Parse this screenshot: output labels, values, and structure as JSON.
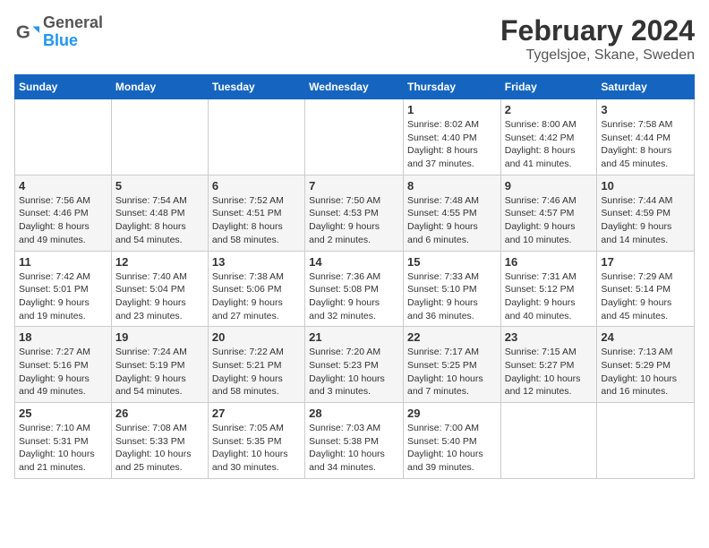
{
  "header": {
    "logo_line1": "General",
    "logo_line2": "Blue",
    "month": "February 2024",
    "location": "Tygelsjoe, Skane, Sweden"
  },
  "days_of_week": [
    "Sunday",
    "Monday",
    "Tuesday",
    "Wednesday",
    "Thursday",
    "Friday",
    "Saturday"
  ],
  "weeks": [
    [
      {
        "day": "",
        "detail": ""
      },
      {
        "day": "",
        "detail": ""
      },
      {
        "day": "",
        "detail": ""
      },
      {
        "day": "",
        "detail": ""
      },
      {
        "day": "1",
        "detail": "Sunrise: 8:02 AM\nSunset: 4:40 PM\nDaylight: 8 hours\nand 37 minutes."
      },
      {
        "day": "2",
        "detail": "Sunrise: 8:00 AM\nSunset: 4:42 PM\nDaylight: 8 hours\nand 41 minutes."
      },
      {
        "day": "3",
        "detail": "Sunrise: 7:58 AM\nSunset: 4:44 PM\nDaylight: 8 hours\nand 45 minutes."
      }
    ],
    [
      {
        "day": "4",
        "detail": "Sunrise: 7:56 AM\nSunset: 4:46 PM\nDaylight: 8 hours\nand 49 minutes."
      },
      {
        "day": "5",
        "detail": "Sunrise: 7:54 AM\nSunset: 4:48 PM\nDaylight: 8 hours\nand 54 minutes."
      },
      {
        "day": "6",
        "detail": "Sunrise: 7:52 AM\nSunset: 4:51 PM\nDaylight: 8 hours\nand 58 minutes."
      },
      {
        "day": "7",
        "detail": "Sunrise: 7:50 AM\nSunset: 4:53 PM\nDaylight: 9 hours\nand 2 minutes."
      },
      {
        "day": "8",
        "detail": "Sunrise: 7:48 AM\nSunset: 4:55 PM\nDaylight: 9 hours\nand 6 minutes."
      },
      {
        "day": "9",
        "detail": "Sunrise: 7:46 AM\nSunset: 4:57 PM\nDaylight: 9 hours\nand 10 minutes."
      },
      {
        "day": "10",
        "detail": "Sunrise: 7:44 AM\nSunset: 4:59 PM\nDaylight: 9 hours\nand 14 minutes."
      }
    ],
    [
      {
        "day": "11",
        "detail": "Sunrise: 7:42 AM\nSunset: 5:01 PM\nDaylight: 9 hours\nand 19 minutes."
      },
      {
        "day": "12",
        "detail": "Sunrise: 7:40 AM\nSunset: 5:04 PM\nDaylight: 9 hours\nand 23 minutes."
      },
      {
        "day": "13",
        "detail": "Sunrise: 7:38 AM\nSunset: 5:06 PM\nDaylight: 9 hours\nand 27 minutes."
      },
      {
        "day": "14",
        "detail": "Sunrise: 7:36 AM\nSunset: 5:08 PM\nDaylight: 9 hours\nand 32 minutes."
      },
      {
        "day": "15",
        "detail": "Sunrise: 7:33 AM\nSunset: 5:10 PM\nDaylight: 9 hours\nand 36 minutes."
      },
      {
        "day": "16",
        "detail": "Sunrise: 7:31 AM\nSunset: 5:12 PM\nDaylight: 9 hours\nand 40 minutes."
      },
      {
        "day": "17",
        "detail": "Sunrise: 7:29 AM\nSunset: 5:14 PM\nDaylight: 9 hours\nand 45 minutes."
      }
    ],
    [
      {
        "day": "18",
        "detail": "Sunrise: 7:27 AM\nSunset: 5:16 PM\nDaylight: 9 hours\nand 49 minutes."
      },
      {
        "day": "19",
        "detail": "Sunrise: 7:24 AM\nSunset: 5:19 PM\nDaylight: 9 hours\nand 54 minutes."
      },
      {
        "day": "20",
        "detail": "Sunrise: 7:22 AM\nSunset: 5:21 PM\nDaylight: 9 hours\nand 58 minutes."
      },
      {
        "day": "21",
        "detail": "Sunrise: 7:20 AM\nSunset: 5:23 PM\nDaylight: 10 hours\nand 3 minutes."
      },
      {
        "day": "22",
        "detail": "Sunrise: 7:17 AM\nSunset: 5:25 PM\nDaylight: 10 hours\nand 7 minutes."
      },
      {
        "day": "23",
        "detail": "Sunrise: 7:15 AM\nSunset: 5:27 PM\nDaylight: 10 hours\nand 12 minutes."
      },
      {
        "day": "24",
        "detail": "Sunrise: 7:13 AM\nSunset: 5:29 PM\nDaylight: 10 hours\nand 16 minutes."
      }
    ],
    [
      {
        "day": "25",
        "detail": "Sunrise: 7:10 AM\nSunset: 5:31 PM\nDaylight: 10 hours\nand 21 minutes."
      },
      {
        "day": "26",
        "detail": "Sunrise: 7:08 AM\nSunset: 5:33 PM\nDaylight: 10 hours\nand 25 minutes."
      },
      {
        "day": "27",
        "detail": "Sunrise: 7:05 AM\nSunset: 5:35 PM\nDaylight: 10 hours\nand 30 minutes."
      },
      {
        "day": "28",
        "detail": "Sunrise: 7:03 AM\nSunset: 5:38 PM\nDaylight: 10 hours\nand 34 minutes."
      },
      {
        "day": "29",
        "detail": "Sunrise: 7:00 AM\nSunset: 5:40 PM\nDaylight: 10 hours\nand 39 minutes."
      },
      {
        "day": "",
        "detail": ""
      },
      {
        "day": "",
        "detail": ""
      }
    ]
  ]
}
